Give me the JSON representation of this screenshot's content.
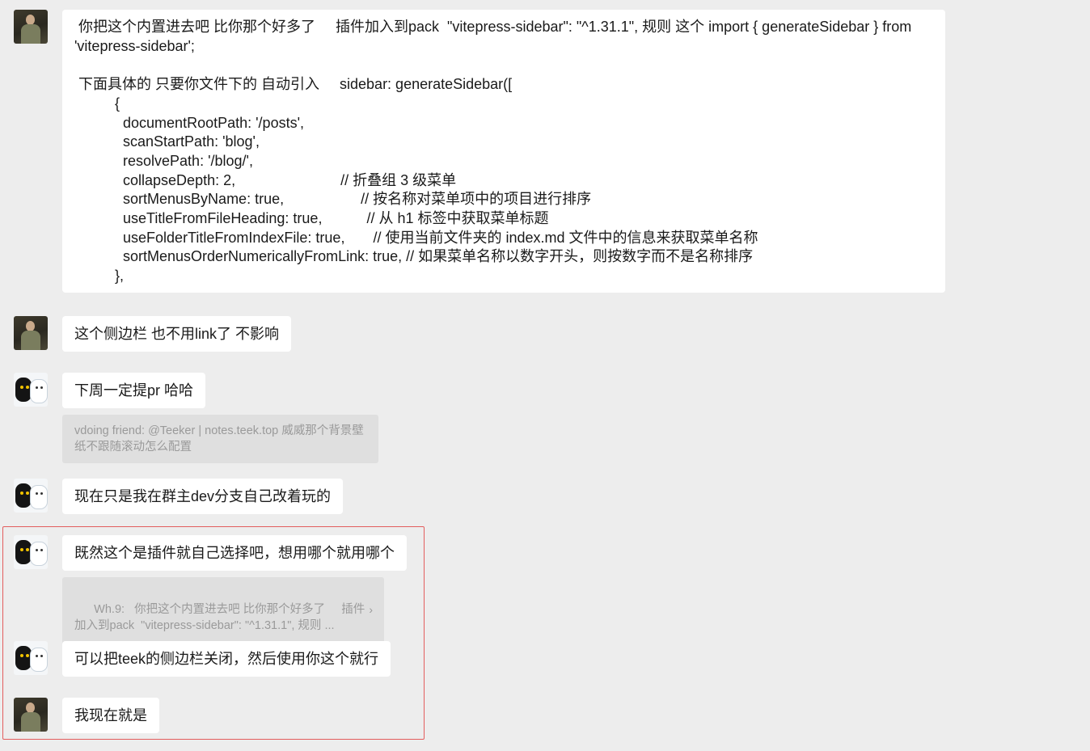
{
  "messages": [
    {
      "sender_avatar": "avatar-a",
      "text": " 你把这个内置进去吧 比你那个好多了     插件加入到pack  \"vitepress-sidebar\": \"^1.31.1\", 规则 这个 import { generateSidebar } from 'vitepress-sidebar';\n\n 下面具体的 只要你文件下的 自动引入     sidebar: generateSidebar([\n          {\n            documentRootPath: '/posts',\n            scanStartPath: 'blog',\n            resolvePath: '/blog/',\n            collapseDepth: 2,                          // 折叠组 3 级菜单\n            sortMenusByName: true,                   // 按名称对菜单项中的项目进行排序\n            useTitleFromFileHeading: true,           // 从 h1 标签中获取菜单标题\n            useFolderTitleFromIndexFile: true,       // 使用当前文件夹的 index.md 文件中的信息来获取菜单名称\n            sortMenusOrderNumericallyFromLink: true, // 如果菜单名称以数字开头，则按数字而不是名称排序\n          },"
    },
    {
      "sender_avatar": "avatar-a",
      "text": "这个侧边栏 也不用link了 不影响"
    },
    {
      "sender_avatar": "avatar-b",
      "text": "下周一定提pr 哈哈",
      "quote": "vdoing friend: @Teeker | notes.teek.top 威威那个背景壁纸不跟随滚动怎么配置"
    },
    {
      "sender_avatar": "avatar-b",
      "text": "现在只是我在群主dev分支自己改着玩的"
    },
    {
      "sender_avatar": "avatar-b",
      "text": "既然这个是插件就自己选择吧，想用哪个就用哪个",
      "quote": "Wh.9:   你把这个内置进去吧 比你那个好多了     插件加入到pack  \"vitepress-sidebar\": \"^1.31.1\", 规则 ...",
      "quote_chevron": "›"
    },
    {
      "sender_avatar": "avatar-b",
      "text": "可以把teek的侧边栏关闭，然后使用你这个就行"
    },
    {
      "sender_avatar": "avatar-a",
      "text": "我现在就是"
    }
  ],
  "colors": {
    "background": "#ededed",
    "bubble": "#ffffff",
    "quote": "#dfdfdf",
    "highlight_border": "#e35d5d"
  }
}
